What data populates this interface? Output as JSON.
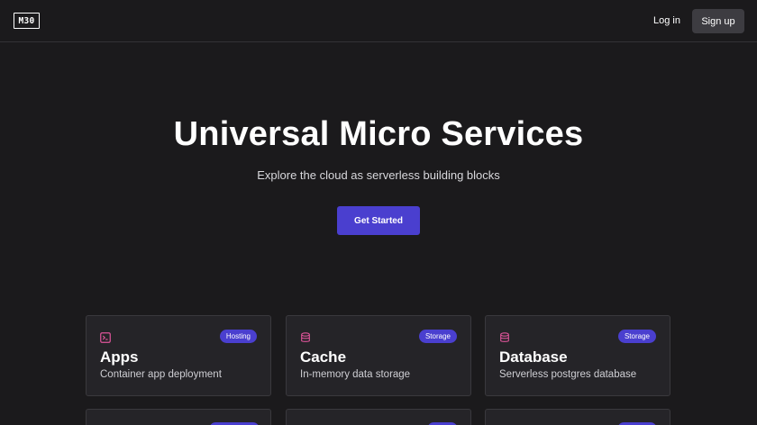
{
  "header": {
    "logo": "M30",
    "login_label": "Log in",
    "signup_label": "Sign up"
  },
  "hero": {
    "title": "Universal Micro Services",
    "subtitle": "Explore the cloud as serverless building blocks",
    "cta_label": "Get Started"
  },
  "cards": [
    {
      "title": "Apps",
      "description": "Container app deployment",
      "badge": "Hosting",
      "icon": "terminal-icon"
    },
    {
      "title": "Cache",
      "description": "In-memory data storage",
      "badge": "Storage",
      "icon": "database-icon"
    },
    {
      "title": "Database",
      "description": "Serverless postgres database",
      "badge": "Storage",
      "icon": "database-icon"
    }
  ],
  "colors": {
    "background": "#1b1a1c",
    "card": "#252428",
    "accent": "#4a3fcf",
    "icon": "#e0559b"
  }
}
